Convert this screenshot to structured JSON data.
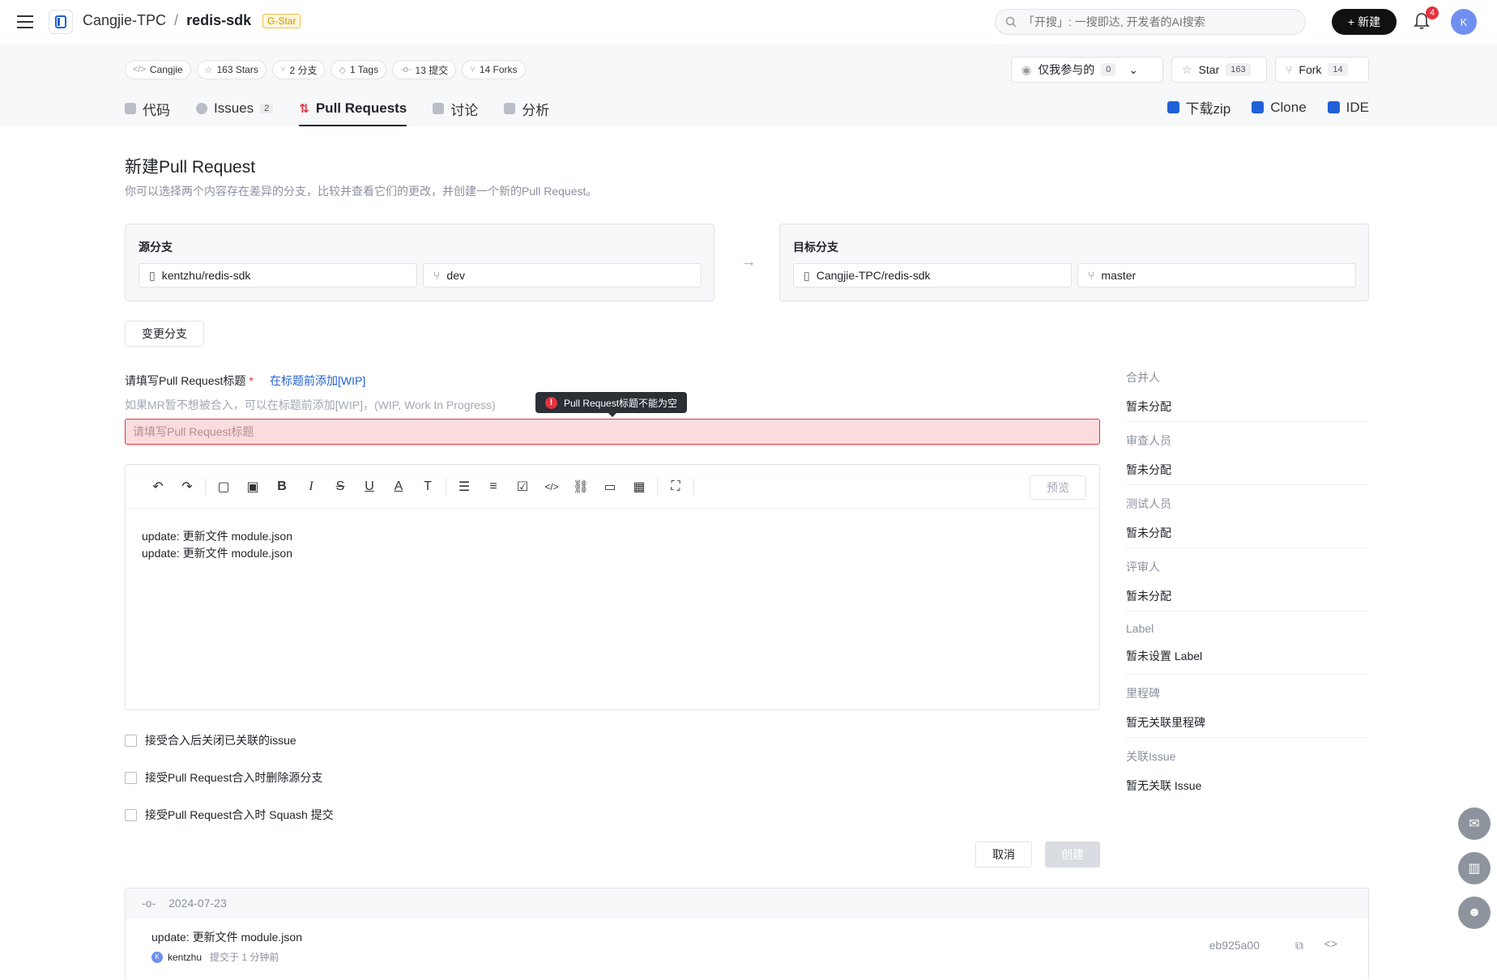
{
  "topbar": {
    "owner": "Cangjie-TPC",
    "separator": "/",
    "repo": "redis-sdk",
    "badge": "G-Star",
    "search_placeholder": "「开搜」: 一搜即达, 开发者的AI搜索",
    "new_label": "新建",
    "notification_count": "4",
    "avatar_initial": "K"
  },
  "chips": [
    {
      "icon": "code-icon",
      "label": "Cangjie"
    },
    {
      "icon": "star-icon",
      "label": "163 Stars"
    },
    {
      "icon": "branch-icon",
      "label": "2 分支"
    },
    {
      "icon": "tag-icon",
      "label": "1 Tags"
    },
    {
      "icon": "commit-icon",
      "label": "13 提交"
    },
    {
      "icon": "fork-icon",
      "label": "14 Forks"
    }
  ],
  "actions": {
    "watch_label": "仅我参与的",
    "watch_count": "0",
    "star_label": "Star",
    "star_count": "163",
    "fork_label": "Fork",
    "fork_count": "14"
  },
  "tabs": [
    {
      "label": "代码",
      "count": ""
    },
    {
      "label": "Issues",
      "count": "2"
    },
    {
      "label": "Pull Requests",
      "count": ""
    },
    {
      "label": "讨论",
      "count": ""
    },
    {
      "label": "分析",
      "count": ""
    }
  ],
  "tools": {
    "download": "下载zip",
    "clone": "Clone",
    "ide": "IDE"
  },
  "page": {
    "title": "新建Pull Request",
    "description": "你可以选择两个内容存在差异的分支，比较并查看它们的更改，并创建一个新的Pull Request。"
  },
  "source": {
    "label": "源分支",
    "repo": "kentzhu/redis-sdk",
    "branch": "dev"
  },
  "target": {
    "label": "目标分支",
    "repo": "Cangjie-TPC/redis-sdk",
    "branch": "master"
  },
  "change_branch_label": "变更分支",
  "form": {
    "title_label": "请填写Pull Request标题",
    "required_mark": "*",
    "wip_link": "在标题前添加[WIP]",
    "hint": "如果MR暂不想被合入，可以在标题前添加[WIP]，(WIP, Work In Progress)",
    "title_placeholder": "请填写Pull Request标题",
    "title_value": "",
    "error_tooltip": "Pull Request标题不能为空",
    "preview_label": "预览",
    "body_lines": [
      "update: 更新文件 module.json",
      "update: 更新文件 module.json"
    ]
  },
  "options": [
    {
      "label": "接受合入后关闭已关联的issue",
      "checked": false
    },
    {
      "label": "接受Pull Request合入时删除源分支",
      "checked": false
    },
    {
      "label": "接受Pull Request合入时 Squash 提交",
      "checked": false
    }
  ],
  "buttons": {
    "cancel": "取消",
    "create": "创建"
  },
  "sidebar": [
    {
      "label": "合并人",
      "value": "暂未分配"
    },
    {
      "label": "审查人员",
      "value": "暂未分配"
    },
    {
      "label": "测试人员",
      "value": "暂未分配"
    },
    {
      "label": "评审人",
      "value": "暂未分配"
    },
    {
      "label": "Label",
      "value": "暂未设置 Label"
    },
    {
      "label": "里程碑",
      "value": "暂无关联里程碑"
    },
    {
      "label": "关联Issue",
      "value": "暂无关联 Issue"
    }
  ],
  "commits": {
    "date": "2024-07-23",
    "items": [
      {
        "message": "update: 更新文件 module.json",
        "author": "kentzhu",
        "author_initial": "K",
        "time": "提交于 1 分钟前",
        "hash": "eb925a00"
      }
    ]
  },
  "colors": {
    "accent": "#2160d6",
    "error": "#e5323e",
    "error_bg": "#fadcdf",
    "primary_dark": "#111111"
  }
}
